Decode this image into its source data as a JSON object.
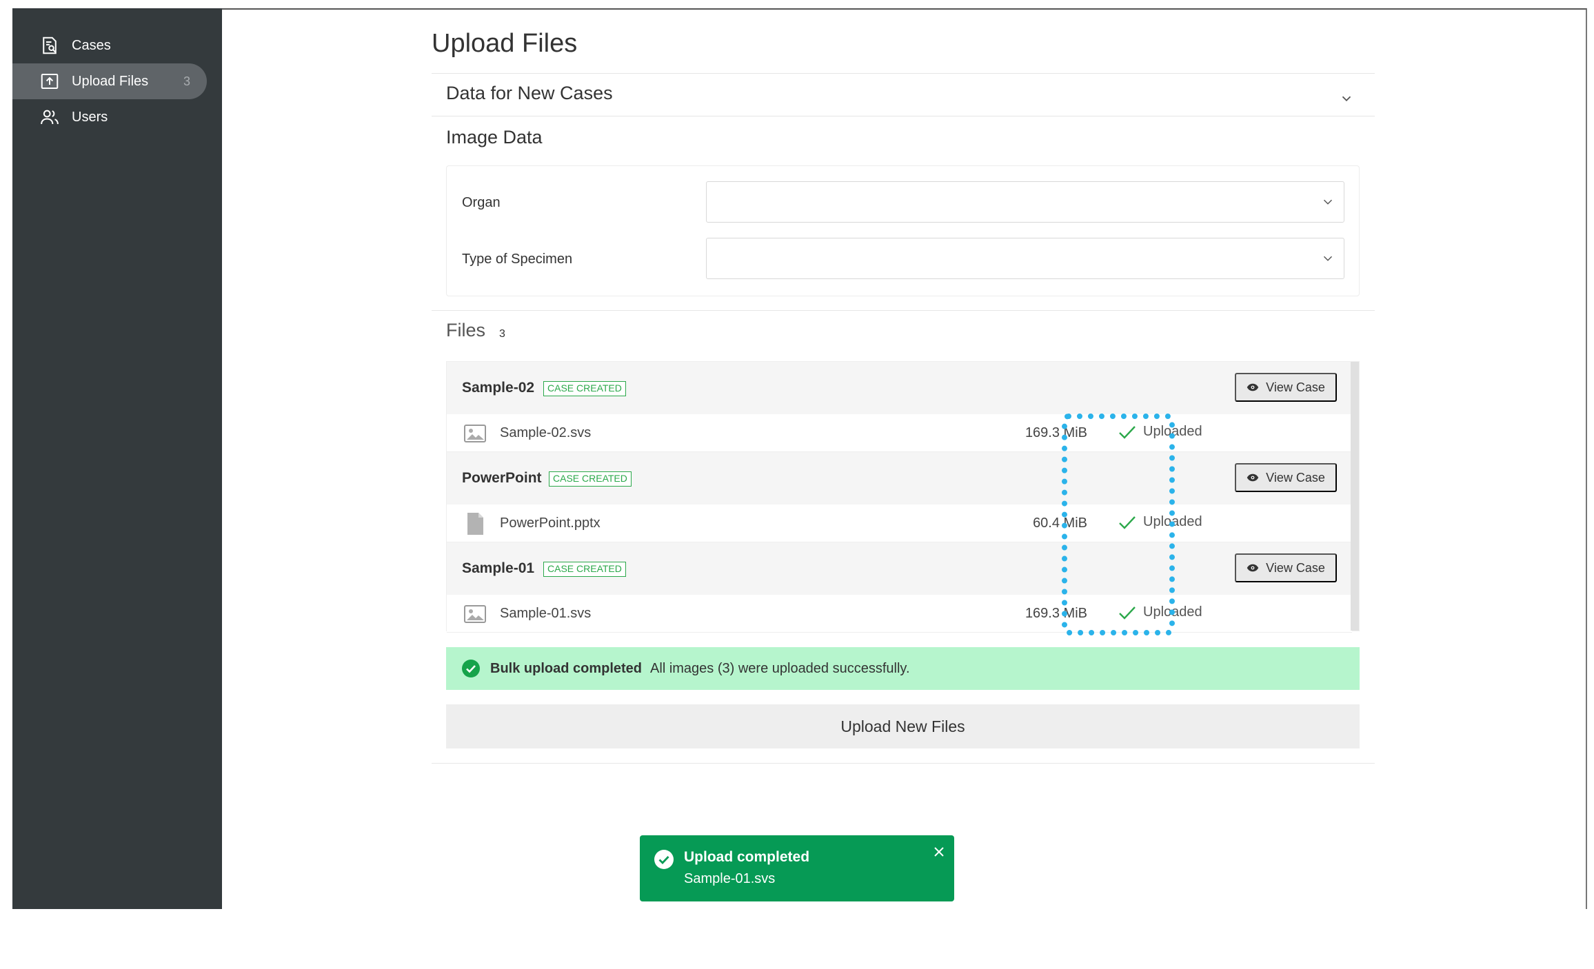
{
  "sidebar": {
    "items": [
      {
        "label": "Cases",
        "icon": "cases-icon"
      },
      {
        "label": "Upload Files",
        "icon": "upload-icon",
        "badge": "3",
        "active": true
      },
      {
        "label": "Users",
        "icon": "users-icon"
      }
    ]
  },
  "page": {
    "title": "Upload Files",
    "section_new_cases": "Data for New Cases",
    "section_image_data": "Image Data",
    "fields": {
      "organ_label": "Organ",
      "organ_value": "",
      "specimen_label": "Type of Specimen",
      "specimen_value": ""
    },
    "files_title": "Files",
    "files_count": "3"
  },
  "files": [
    {
      "case": "Sample-02",
      "badge": "CASE CREATED",
      "view_label": "View Case",
      "file_name": "Sample-02.svs",
      "file_type": "image",
      "size": "169.3 MiB",
      "status": "Uploaded"
    },
    {
      "case": "PowerPoint",
      "badge": "CASE CREATED",
      "view_label": "View Case",
      "file_name": "PowerPoint.pptx",
      "file_type": "document",
      "size": "60.4 MiB",
      "status": "Uploaded"
    },
    {
      "case": "Sample-01",
      "badge": "CASE CREATED",
      "view_label": "View Case",
      "file_name": "Sample-01.svs",
      "file_type": "image",
      "size": "169.3 MiB",
      "status": "Uploaded"
    }
  ],
  "alert": {
    "title": "Bulk upload completed",
    "message": "All images (3) were uploaded successfully."
  },
  "upload_button_label": "Upload New Files",
  "toast": {
    "title": "Upload completed",
    "message": "Sample-01.svs"
  },
  "colors": {
    "sidebar_bg": "#343a3d",
    "success_green": "#2ba84a",
    "toast_bg": "#069a55",
    "alert_bg": "#b6f5cd",
    "highlight": "#2bb3ea"
  }
}
